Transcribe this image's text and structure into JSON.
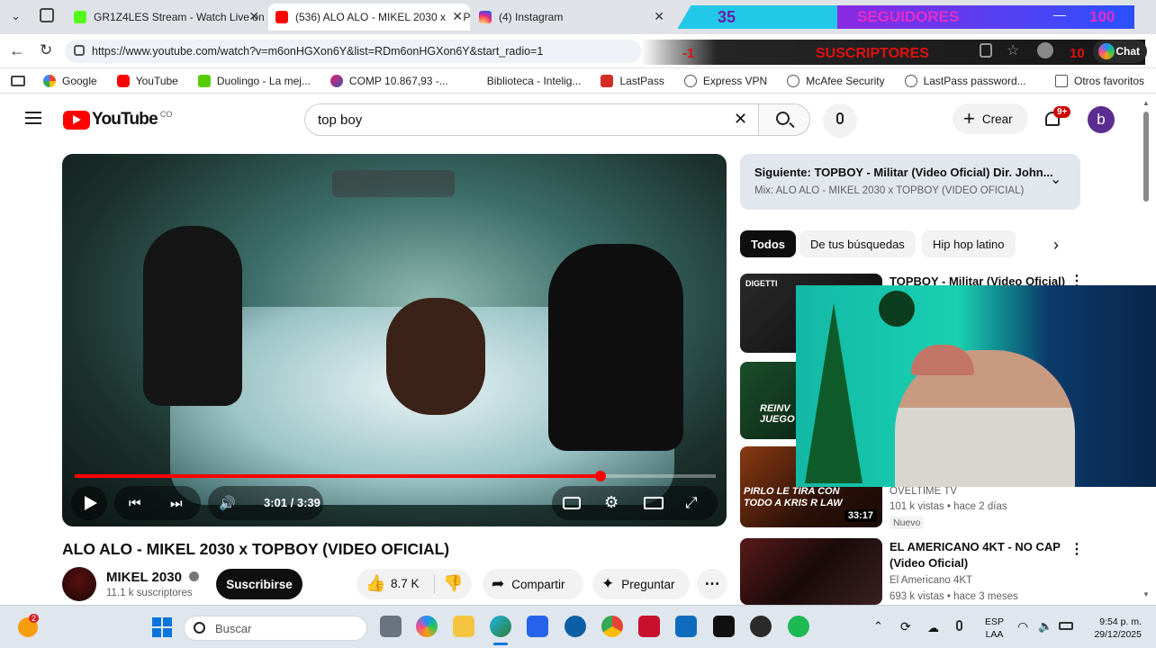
{
  "browser": {
    "tabs": [
      {
        "title": "GR1Z4LES Stream - Watch Live on",
        "color": "#53fc18"
      },
      {
        "title": "(536) ALO ALO - MIKEL 2030 x TOP",
        "color": "#ff0000"
      },
      {
        "title": "(4) Instagram",
        "color": "#e1306c"
      }
    ],
    "url": "https://www.youtube.com/watch?v=m6onHGXon6Y&list=RDm6onHGXon6Y&start_radio=1",
    "chat_label": "Chat",
    "bookmarks": [
      "Google",
      "YouTube",
      "Duolingo - La mej...",
      "COMP 10.867,93 -...",
      "Biblioteca - Intelig...",
      "LastPass",
      "Express VPN",
      "McAfee Security",
      "LastPass password..."
    ],
    "other_favorites": "Otros favoritos"
  },
  "overlay": {
    "followers_count": "35",
    "followers_label": "SEGUIDORES",
    "followers_goal": "100",
    "subs_count": "-1",
    "subs_label": "SUSCRIPTORES",
    "subs_goal": "10"
  },
  "youtube": {
    "logo_text": "YouTube",
    "country": "CO",
    "search_value": "top boy",
    "create_label": "Crear",
    "notif_badge": "9+",
    "avatar_letter": "b",
    "player": {
      "time": "3:01 / 3:39",
      "progress": 0.82
    },
    "video_title": "ALO ALO - MIKEL 2030 x TOPBOY (VIDEO OFICIAL)",
    "channel": {
      "name": "MIKEL 2030",
      "subs": "11.1 k suscriptores",
      "subscribe": "Suscribirse"
    },
    "actions": {
      "likes": "8.7 K",
      "share": "Compartir",
      "ask": "Preguntar"
    },
    "next": {
      "title": "Siguiente: TOPBOY - Militar (Video Oficial) Dir. John...",
      "mix": "Mix: ALO ALO - MIKEL 2030 x TOPBOY (VIDEO OFICIAL)"
    },
    "chips": [
      "Todos",
      "De tus búsquedas",
      "Hip hop latino"
    ],
    "related": [
      {
        "title": "TOPBOY - Militar (Video Oficial)",
        "thumb_text": "DIGETTI"
      },
      {
        "title": "",
        "thumb_text": "REINV JUEGO"
      },
      {
        "title": "",
        "channel": "OVELTIME TV",
        "meta": "101 k vistas • hace 2 días",
        "badge": "Nuevo",
        "duration": "33:17",
        "thumb_text": "PIRLO LE TIRA CON TODO A KRIS R LAW"
      },
      {
        "title": "EL AMERICANO 4KT - NO CAP (Video Oficial)",
        "channel": "El Americano 4KT",
        "meta": "693 k vistas • hace 3 meses"
      }
    ]
  },
  "taskbar": {
    "search_placeholder": "Buscar",
    "lang": "ESP",
    "lang2": "LAA",
    "time": "9:54 p. m.",
    "date": "29/12/2025",
    "weather_badge": "2"
  }
}
